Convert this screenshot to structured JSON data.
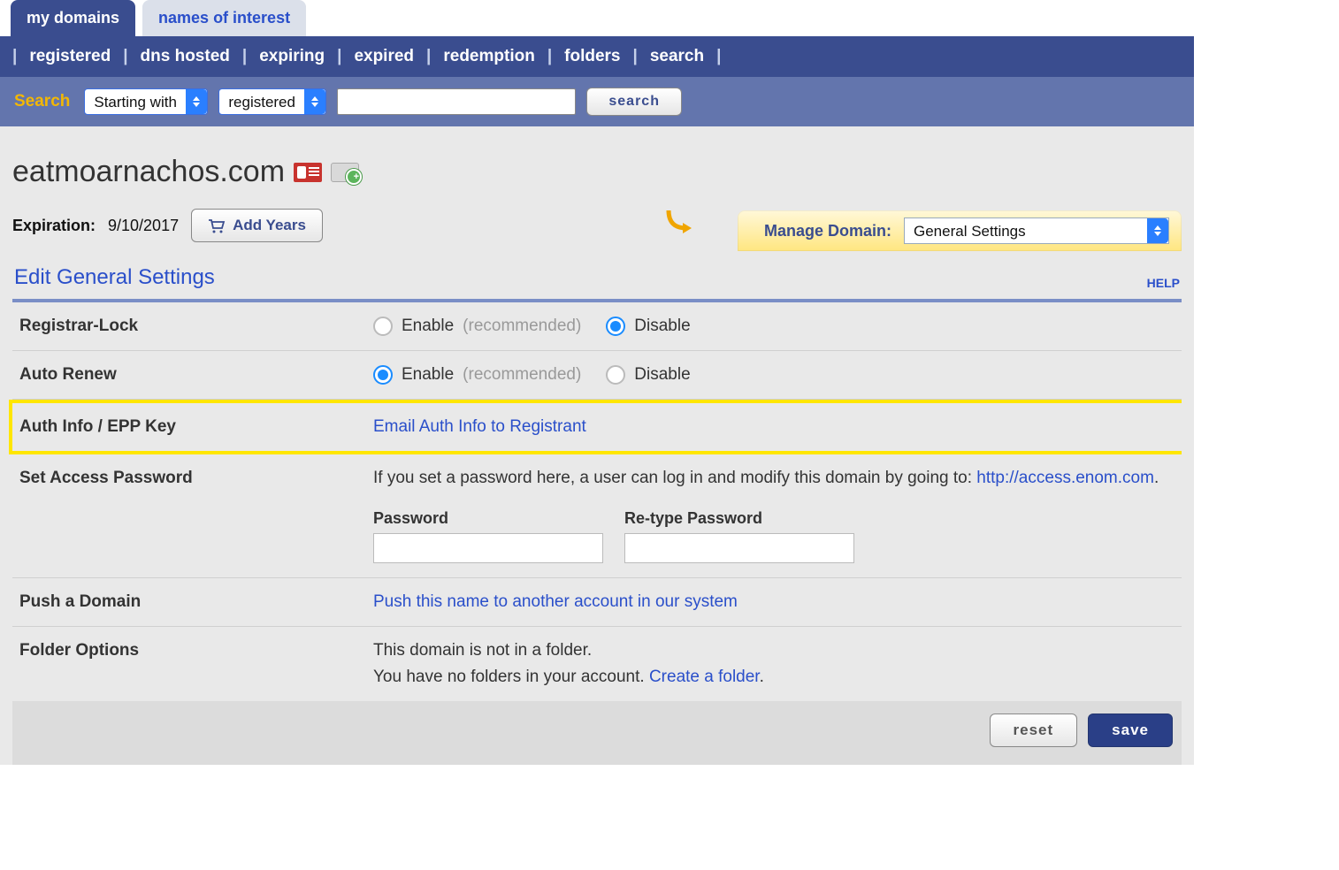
{
  "tabs": {
    "my_domains": "my domains",
    "names_of_interest": "names of interest"
  },
  "subnav": [
    "registered",
    "dns hosted",
    "expiring",
    "expired",
    "redemption",
    "folders",
    "search"
  ],
  "searchbar": {
    "label": "Search",
    "filter_selected": "Starting with",
    "status_selected": "registered",
    "button": "search"
  },
  "domain": {
    "name": "eatmoarnachos.com",
    "expiration_label": "Expiration:",
    "expiration_date": "9/10/2017",
    "add_years": "Add Years"
  },
  "manage": {
    "label": "Manage Domain:",
    "selected": "General Settings"
  },
  "section": {
    "title": "Edit General Settings",
    "help": "HELP"
  },
  "rows": {
    "registrar_lock": {
      "label": "Registrar-Lock",
      "enable": "Enable",
      "recommended": "(recommended)",
      "disable": "Disable"
    },
    "auto_renew": {
      "label": "Auto Renew",
      "enable": "Enable",
      "recommended": "(recommended)",
      "disable": "Disable"
    },
    "auth_info": {
      "label": "Auth Info / EPP Key",
      "link": "Email Auth Info to Registrant"
    },
    "set_password": {
      "label": "Set Access Password",
      "text_pre": "If you set a password here, a user can log in and modify this domain by going to: ",
      "url": "http://access.enom.com",
      "period": ".",
      "pw_label": "Password",
      "retype_label": "Re-type Password"
    },
    "push": {
      "label": "Push a Domain",
      "link": "Push this name to another account in our system"
    },
    "folder": {
      "label": "Folder Options",
      "line1": "This domain is not in a folder.",
      "line2": " You have no folders in your account. ",
      "create_link": "Create a folder",
      "period": "."
    }
  },
  "actions": {
    "reset": "reset",
    "save": "save"
  }
}
